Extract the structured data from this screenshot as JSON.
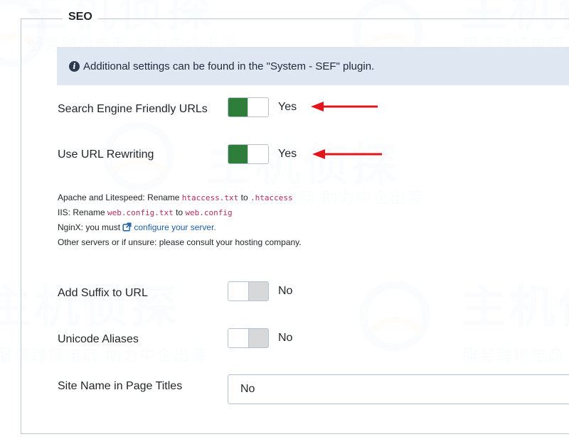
{
  "watermark": {
    "brand": "主机侦探",
    "slogan": "服务跨境电商 助力中企出海"
  },
  "fieldset": {
    "legend": "SEO"
  },
  "alert": {
    "icon": "info-icon",
    "text": "Additional settings can be found in the \"System - SEF\" plugin."
  },
  "fields": {
    "sef_urls": {
      "label": "Search Engine Friendly URLs",
      "state": "Yes",
      "on": true
    },
    "url_rewriting": {
      "label": "Use URL Rewriting",
      "state": "Yes",
      "on": true
    },
    "suffix": {
      "label": "Add Suffix to URL",
      "state": "No",
      "on": false
    },
    "unicode": {
      "label": "Unicode Aliases",
      "state": "No",
      "on": false
    },
    "sitename": {
      "label": "Site Name in Page Titles",
      "value": "No"
    }
  },
  "help": {
    "line1_prefix": "Apache and Litespeed: Rename ",
    "line1_code1": "htaccess.txt",
    "line1_mid": " to ",
    "line1_code2": ".htaccess",
    "line2_prefix": "IIS: Rename ",
    "line2_code1": "web.config.txt",
    "line2_mid": " to ",
    "line2_code2": "web.config",
    "line3_prefix": "NginX: you must ",
    "line3_link": "configure your server.",
    "line4": "Other servers or if unsure: please consult your hosting company."
  },
  "colors": {
    "toggle_on": "#2e7d3a",
    "toggle_off": "#d6d8da",
    "alert_bg": "#dfe8f2",
    "arrow": "#e3141b",
    "code": "#b32d5a",
    "link": "#1d5fa3"
  }
}
